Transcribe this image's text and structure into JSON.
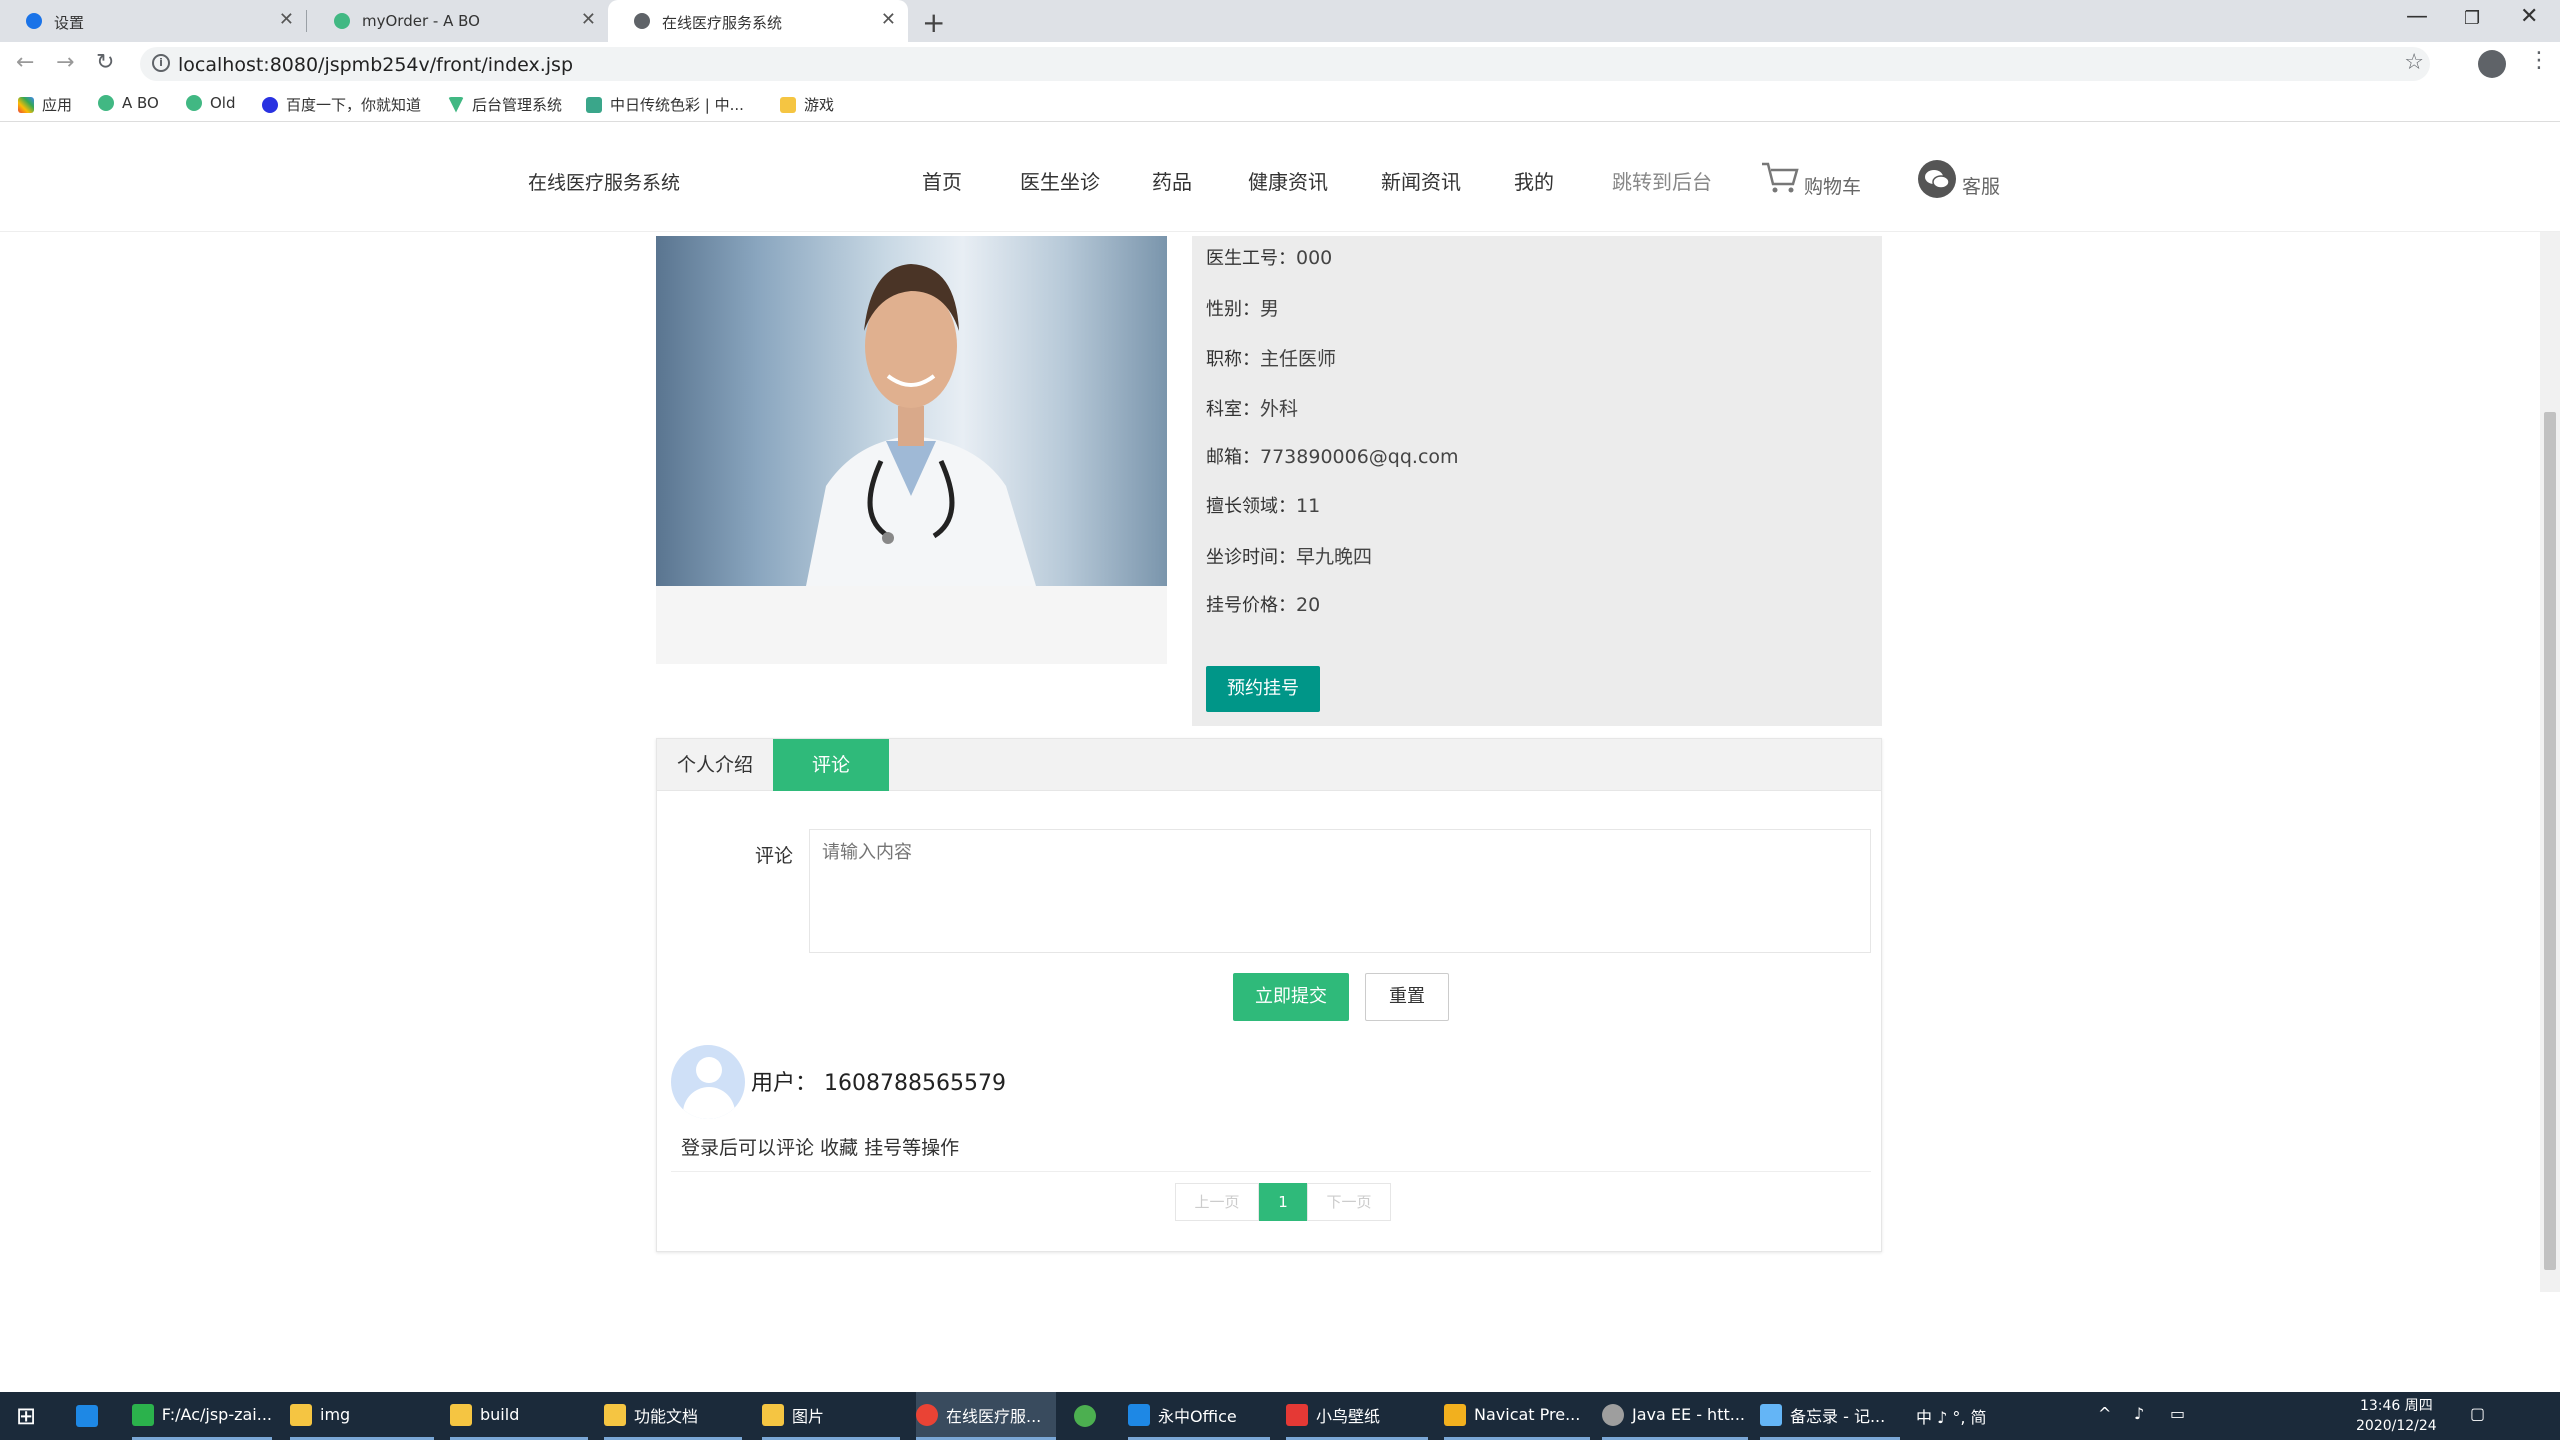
{
  "browser": {
    "tabs": [
      {
        "title": "设置",
        "icon": "gear-icon"
      },
      {
        "title": "myOrder - A BO",
        "icon": "vue-icon"
      },
      {
        "title": "在线医疗服务系统",
        "icon": "globe-icon"
      }
    ],
    "url": "localhost:8080/jspmb254v/front/index.jsp",
    "bookmarks": [
      "应用",
      "A BO",
      "Old",
      "百度一下，你就知道",
      "后台管理系统",
      "中日传统色彩 | 中...",
      "游戏"
    ]
  },
  "site": {
    "brand": "在线医疗服务系统",
    "nav": [
      "首页",
      "医生坐诊",
      "药品",
      "健康资讯",
      "新闻资讯",
      "我的",
      "跳转到后台"
    ],
    "cart": "购物车",
    "service": "客服"
  },
  "doctor": {
    "rows": [
      {
        "label": "医生工号：",
        "value": "000"
      },
      {
        "label": "性别：",
        "value": "男"
      },
      {
        "label": "职称：",
        "value": "主任医师"
      },
      {
        "label": "科室：",
        "value": "外科"
      },
      {
        "label": "邮箱：",
        "value": "773890006@qq.com"
      },
      {
        "label": "擅长领域：",
        "value": "11"
      },
      {
        "label": "坐诊时间：",
        "value": "早九晚四"
      },
      {
        "label": "挂号价格：",
        "value": "20"
      }
    ],
    "appoint_button": "预约挂号"
  },
  "tabs": {
    "items": [
      "个人介绍",
      "评论"
    ],
    "active": 1
  },
  "comment_form": {
    "label": "评论",
    "placeholder": "请输入内容",
    "submit": "立即提交",
    "reset": "重置"
  },
  "comments": [
    {
      "user": "用户：  1608788565579",
      "text": "登录后可以评论 收藏 挂号等操作"
    }
  ],
  "pager": {
    "prev": "上一页",
    "current": "1",
    "next": "下一页"
  },
  "taskbar": {
    "items": [
      "F:/Ac/jsp-zai...",
      "img",
      "build",
      "功能文档",
      "图片",
      "在线医疗服...",
      "永中Office",
      "小鸟壁纸",
      "Navicat Pre...",
      "Java EE - htt...",
      "备忘录 - 记..."
    ],
    "tray": "中 ♪ °, 简",
    "time": "13:46 周四",
    "date": "2020/12/24"
  },
  "colors": {
    "accent_green": "#2fba7a",
    "teal_button": "#009688"
  }
}
